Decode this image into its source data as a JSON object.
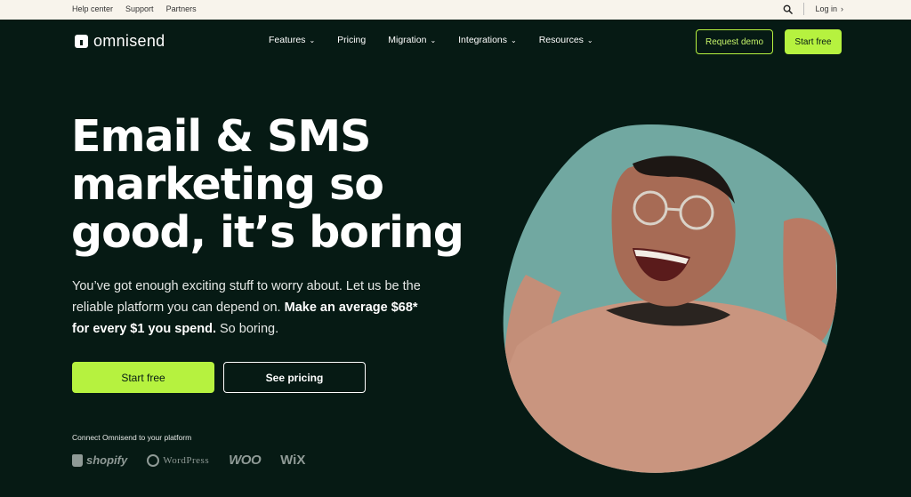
{
  "utility": {
    "links": [
      "Help center",
      "Support",
      "Partners"
    ],
    "login": "Log in"
  },
  "nav": {
    "logo": "omnisend",
    "menu": [
      {
        "label": "Features",
        "dropdown": true
      },
      {
        "label": "Pricing",
        "dropdown": false
      },
      {
        "label": "Migration",
        "dropdown": true
      },
      {
        "label": "Integrations",
        "dropdown": true
      },
      {
        "label": "Resources",
        "dropdown": true
      }
    ],
    "request_demo": "Request demo",
    "start_free": "Start free"
  },
  "hero": {
    "headline_lines": [
      "Email & SMS",
      "marketing so",
      "good, it’s boring"
    ],
    "subtext_plain": "You’ve got enough exciting stuff to worry about. Let us be the reliable platform you can depend on. ",
    "subtext_bold": "Make an average $68* for every $1 you spend.",
    "subtext_end": " So boring.",
    "cta_primary": "Start free",
    "cta_secondary": "See pricing",
    "connect_label": "Connect Omnisend to your platform",
    "platforms": [
      "shopify",
      "WordPress",
      "WOO",
      "WiX"
    ]
  },
  "colors": {
    "background": "#061a14",
    "accent": "#b6f23f",
    "utility_bar": "#f8f4ec",
    "photo_bg": "#6aa39c",
    "sweater": "#c9957f"
  },
  "icons": {
    "search": "search-icon",
    "login_chevron": "chevron-right-icon",
    "dropdown": "chevron-down-icon"
  }
}
